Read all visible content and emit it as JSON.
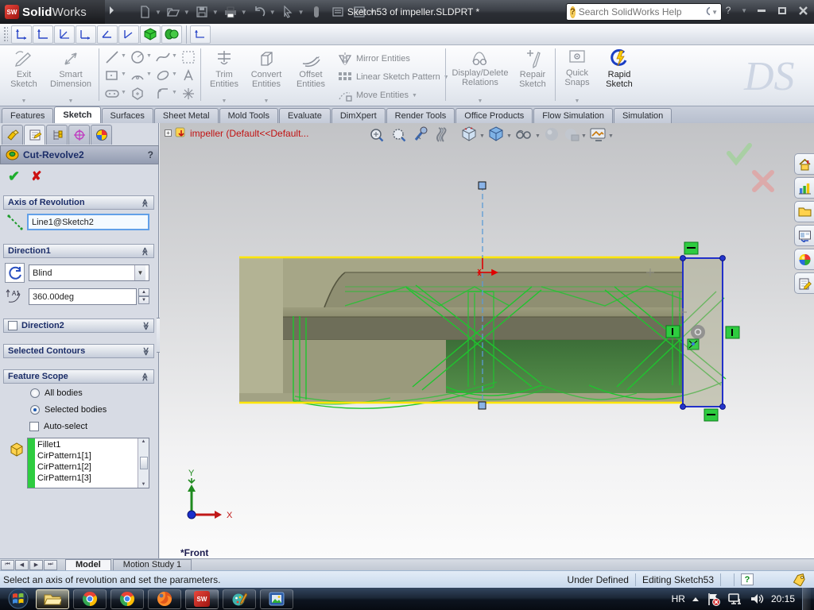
{
  "titlebar": {
    "app_bold": "Solid",
    "app_light": "Works",
    "cube_label": "SW",
    "title": "Sketch53 of impeller.SLDPRT *",
    "search_placeholder": "Search SolidWorks Help",
    "help": "?"
  },
  "ribbon_tabs": [
    "Features",
    "Sketch",
    "Surfaces",
    "Sheet Metal",
    "Mold Tools",
    "Evaluate",
    "DimXpert",
    "Render Tools",
    "Office Products",
    "Flow Simulation",
    "Simulation"
  ],
  "ribbon": {
    "exit_sketch": "Exit Sketch",
    "smart_dimension": "Smart Dimension",
    "trim": "Trim Entities",
    "convert": "Convert Entities",
    "offset": "Offset Entities",
    "mirror": "Mirror Entities",
    "linear_pattern": "Linear Sketch Pattern",
    "move": "Move Entities",
    "display_delete": "Display/Delete Relations",
    "repair": "Repair Sketch",
    "quick_snaps": "Quick Snaps",
    "rapid_sketch": "Rapid Sketch",
    "ds_watermark": "DS"
  },
  "pm": {
    "title": "Cut-Revolve2",
    "help": "?",
    "axis": {
      "title": "Axis of Revolution",
      "value": "Line1@Sketch2"
    },
    "dir1": {
      "title": "Direction1",
      "type": "Blind",
      "angle": "360.00deg",
      "icon_label": "A1"
    },
    "dir2": {
      "title": "Direction2"
    },
    "contours": {
      "title": "Selected Contours"
    },
    "scope": {
      "title": "Feature Scope",
      "all": "All bodies",
      "selected": "Selected bodies",
      "auto": "Auto-select",
      "items": [
        "Fillet1",
        "CirPattern1[1]",
        "CirPattern1[2]",
        "CirPattern1[3]"
      ]
    }
  },
  "viewport": {
    "tree_label": "impeller  (Default<<Default...",
    "front_label": "*Front",
    "axis_x": "X",
    "axis_y": "Y"
  },
  "bottom": {
    "model": "Model",
    "motion": "Motion Study 1"
  },
  "status": {
    "message": "Select an axis of revolution and set the parameters.",
    "state": "Under Defined",
    "editing": "Editing Sketch53",
    "help": "?"
  },
  "tray": {
    "lang": "HR",
    "time": "20:15"
  },
  "colors": {
    "wireframe_green": "#1ec52e",
    "selection_blue": "#2230c9",
    "sketch_yellow": "#ffe600",
    "body_olive": "#a6a687",
    "constraint_green": "#2ecc40"
  }
}
